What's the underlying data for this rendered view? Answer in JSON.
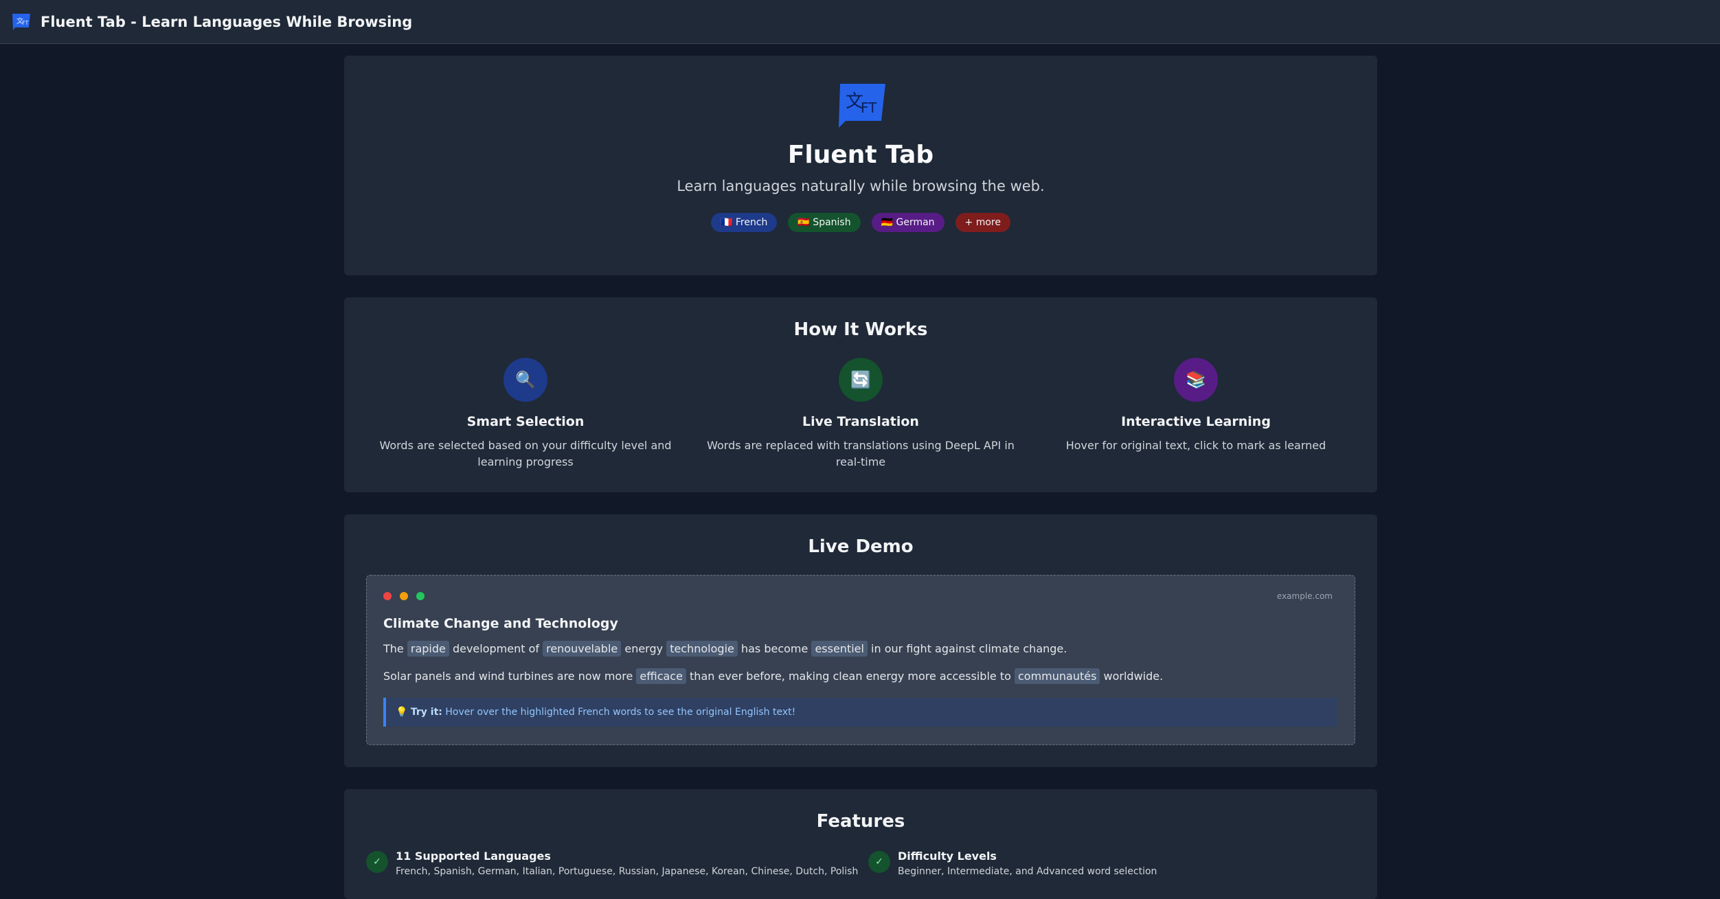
{
  "topbar": {
    "title": "Fluent Tab - Learn Languages While Browsing",
    "logo_icon": "fluent-tab-logo-icon"
  },
  "hero": {
    "title": "Fluent Tab",
    "subtitle": "Learn languages naturally while browsing the web.",
    "logo_text_left": "文",
    "logo_text_right": "FT",
    "badges": [
      {
        "label": "🇫🇷 French",
        "color": "#1e3a8a"
      },
      {
        "label": "🇪🇸 Spanish",
        "color": "#14532d"
      },
      {
        "label": "🇩🇪 German",
        "color": "#581c87"
      },
      {
        "label": "+ more",
        "color": "#7f1d1d"
      }
    ]
  },
  "how": {
    "title": "How It Works",
    "steps": [
      {
        "icon": "🔍",
        "icon_name": "magnifier-icon",
        "color": "#1e3a8a",
        "title": "Smart Selection",
        "desc": "Words are selected based on your difficulty level and learning progress"
      },
      {
        "icon": "🔄",
        "icon_name": "refresh-icon",
        "color": "#14532d",
        "title": "Live Translation",
        "desc": "Words are replaced with translations using DeepL API in real-time"
      },
      {
        "icon": "📚",
        "icon_name": "books-icon",
        "color": "#581c87",
        "title": "Interactive Learning",
        "desc": "Hover for original text, click to mark as learned"
      }
    ]
  },
  "demo": {
    "title": "Live Demo",
    "url": "example.com",
    "dot_colors": [
      "#ef4444",
      "#f59e0b",
      "#22c55e"
    ],
    "article_title": "Climate Change and Technology",
    "p1": {
      "t1": "The",
      "w1": "rapide",
      "t2": "development of",
      "w2": "renouvelable",
      "t3": "energy",
      "w3": "technologie",
      "t4": "has become",
      "w4": "essentiel",
      "t5": "in our fight against climate change."
    },
    "p2": {
      "t1": "Solar panels and wind turbines are now more",
      "w1": "efficace",
      "t2": "than ever before, making clean energy more accessible to",
      "w2": "communautés",
      "t3": "worldwide."
    },
    "tip": {
      "icon": "💡",
      "bold": "Try it:",
      "text": "Hover over the highlighted French words to see the original English text!"
    }
  },
  "features": {
    "title": "Features",
    "items": [
      {
        "title": "11 Supported Languages",
        "desc": "French, Spanish, German, Italian, Portuguese, Russian, Japanese, Korean, Chinese, Dutch, Polish"
      },
      {
        "title": "Difficulty Levels",
        "desc": "Beginner, Intermediate, and Advanced word selection"
      }
    ]
  }
}
